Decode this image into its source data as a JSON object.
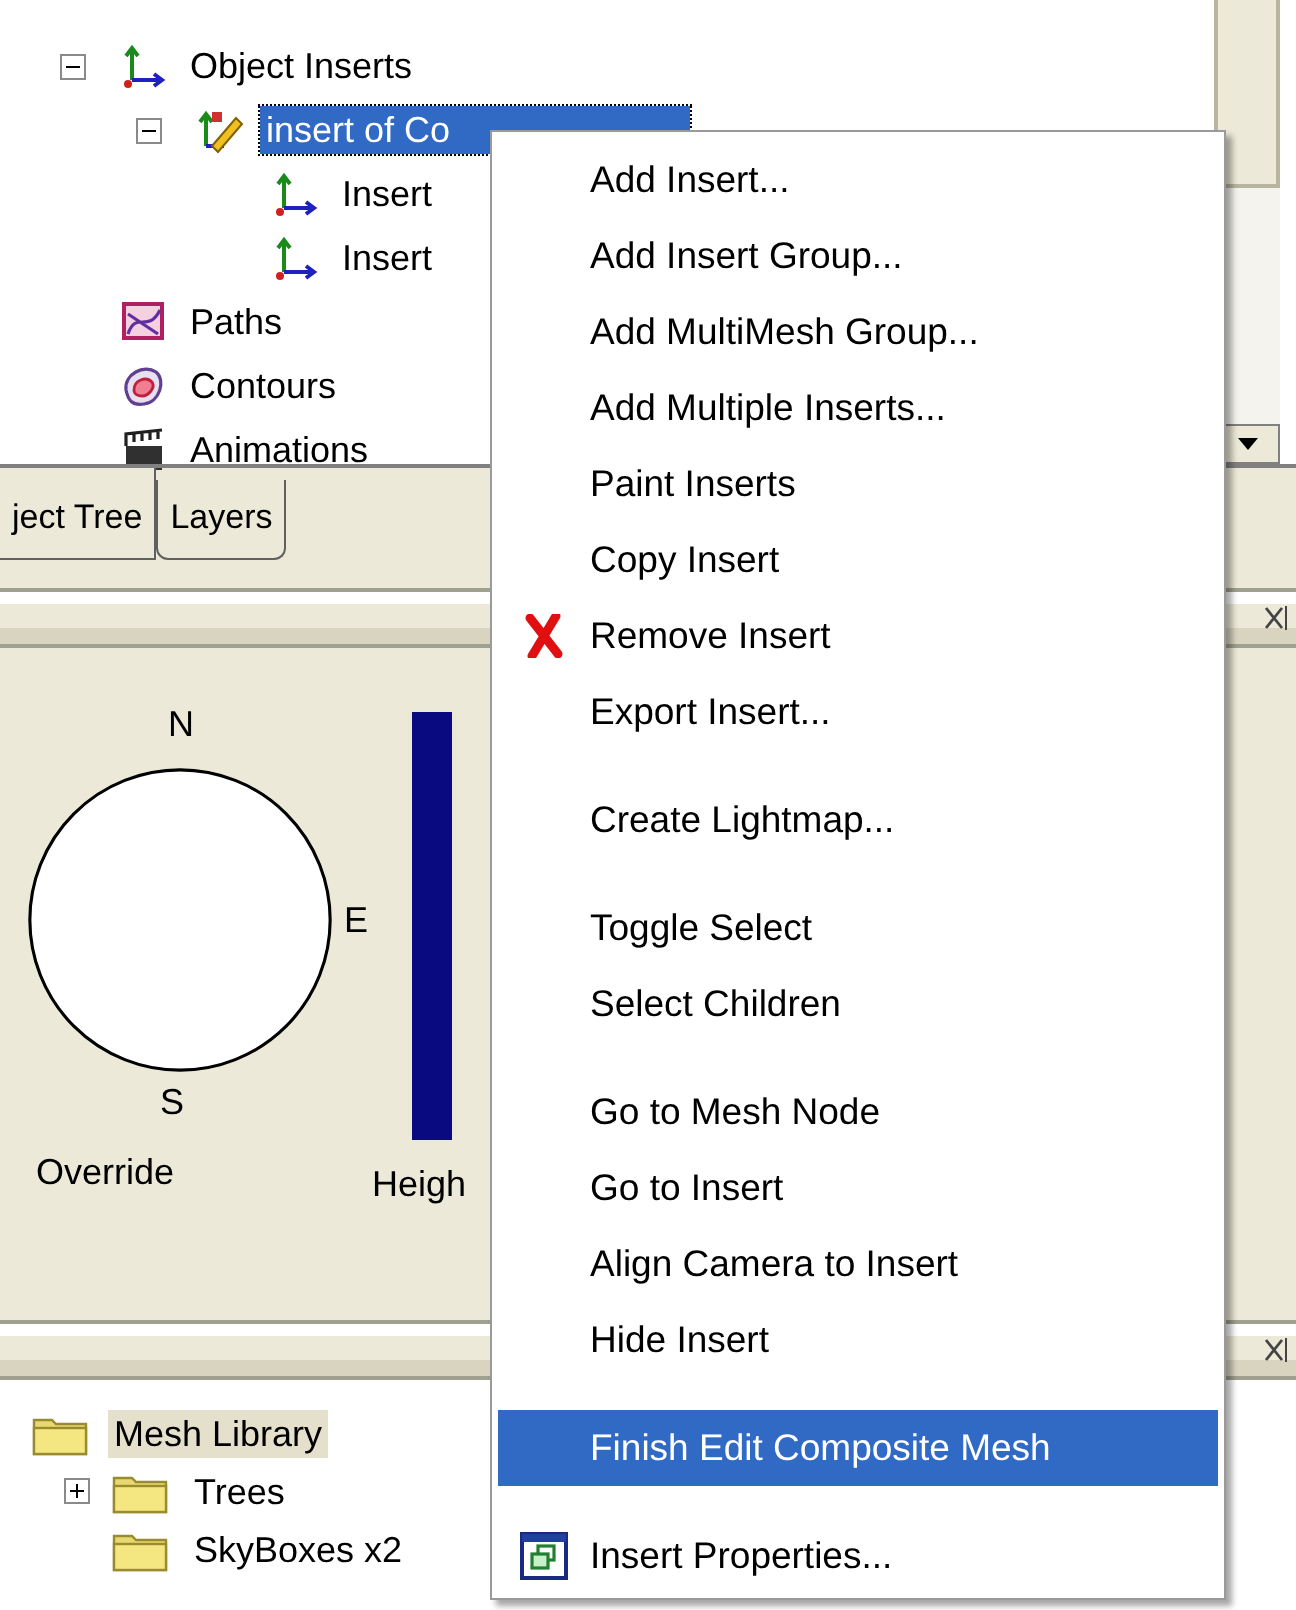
{
  "object_tree": {
    "focused": true,
    "items": [
      {
        "kind": "inserts",
        "label": "Object Inserts",
        "expanded": true,
        "selected": false,
        "children": [
          {
            "kind": "composite",
            "label": "insert of Co",
            "expanded": true,
            "selected": true,
            "children": [
              {
                "kind": "insert",
                "label": "Insert",
                "selected": false
              },
              {
                "kind": "insert",
                "label": "Insert",
                "selected": false
              }
            ]
          }
        ]
      },
      {
        "kind": "paths",
        "label": "Paths",
        "selected": false
      },
      {
        "kind": "contours",
        "label": "Contours",
        "selected": false
      },
      {
        "kind": "animations",
        "label": "Animations",
        "selected": false
      }
    ]
  },
  "panel_tabs": [
    {
      "label": "ject Tree",
      "selected": true
    },
    {
      "label": "Layers",
      "selected": false
    }
  ],
  "sun_panel": {
    "north": "N",
    "east": "E",
    "south": "S",
    "override_label": "Override",
    "height_label": "Heigh"
  },
  "library_tree": {
    "focused": false,
    "items": [
      {
        "kind": "folder",
        "label": "Mesh Library",
        "selected": true,
        "children": [
          {
            "kind": "folder",
            "label": "Trees",
            "expanded": false,
            "selected": false
          },
          {
            "kind": "folder",
            "label": "SkyBoxes x2",
            "selected": false
          }
        ]
      }
    ]
  },
  "context_menu": {
    "items": [
      {
        "kind": "item",
        "label": "Add Insert...",
        "selected": false
      },
      {
        "kind": "item",
        "label": "Add Insert Group...",
        "selected": false
      },
      {
        "kind": "item",
        "label": "Add MultiMesh Group...",
        "selected": false
      },
      {
        "kind": "item",
        "label": "Add Multiple Inserts...",
        "selected": false
      },
      {
        "kind": "item",
        "label": "Paint Inserts",
        "selected": false
      },
      {
        "kind": "item",
        "label": "Copy Insert",
        "selected": false
      },
      {
        "kind": "remove",
        "label": "Remove Insert",
        "selected": false
      },
      {
        "kind": "item",
        "label": "Export Insert...",
        "selected": false
      },
      {
        "kind": "separator"
      },
      {
        "kind": "item",
        "label": "Create Lightmap...",
        "selected": false
      },
      {
        "kind": "separator"
      },
      {
        "kind": "item",
        "label": "Toggle Select",
        "selected": false
      },
      {
        "kind": "item",
        "label": "Select Children",
        "selected": false
      },
      {
        "kind": "separator"
      },
      {
        "kind": "item",
        "label": "Go to Mesh Node",
        "selected": false
      },
      {
        "kind": "item",
        "label": "Go to Insert",
        "selected": false
      },
      {
        "kind": "item",
        "label": "Align Camera to Insert",
        "selected": false
      },
      {
        "kind": "item",
        "label": "Hide Insert",
        "selected": false
      },
      {
        "kind": "separator"
      },
      {
        "kind": "item",
        "label": "Finish Edit Composite Mesh",
        "selected": true
      },
      {
        "kind": "separator"
      },
      {
        "kind": "properties",
        "label": "Insert Properties...",
        "selected": false
      }
    ]
  }
}
